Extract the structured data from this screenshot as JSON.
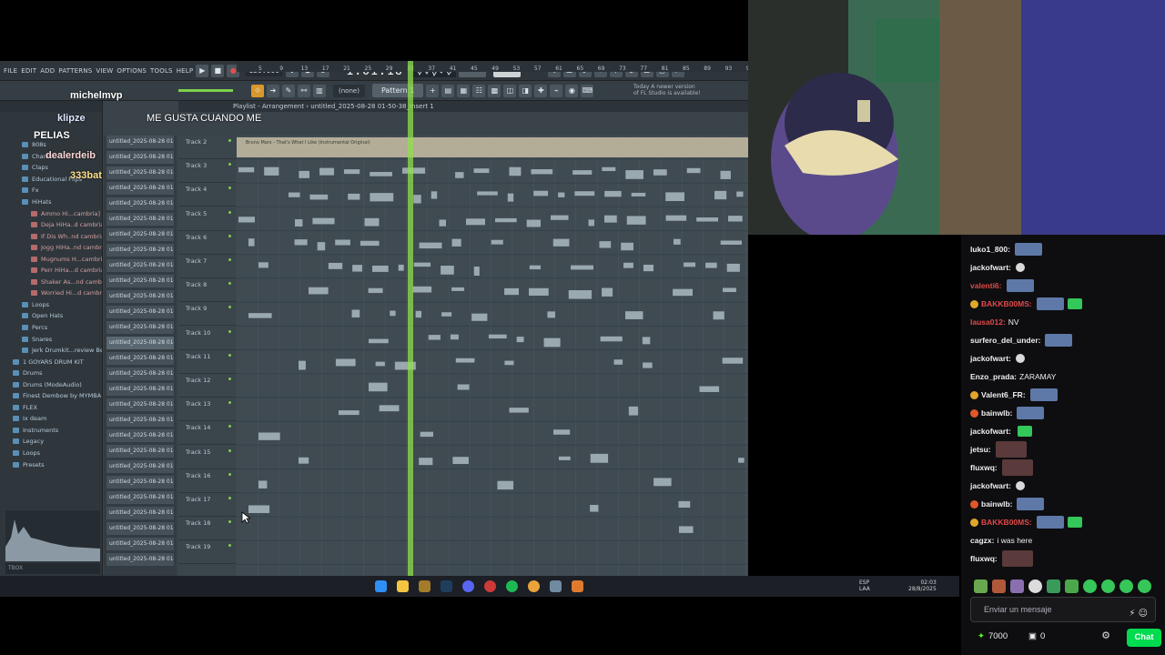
{
  "fl_studio": {
    "menu": [
      "FILE",
      "EDIT",
      "ADD",
      "PATTERNS",
      "VIEW",
      "OPTIONS",
      "TOOLS",
      "HELP"
    ],
    "bpm": "130.000",
    "time": "1:01:16",
    "pattern_select": "(none)",
    "pattern_button": "Pattern 1",
    "update_note": "Today  A newer version of FL Studio is available!",
    "playlist_title": "Playlist - Arrangement  ›  untitled_2025-08-28 01-50-38_Insert 1",
    "browser": {
      "items": [
        {
          "label": "808s",
          "level": 1
        },
        {
          "label": "Chants",
          "level": 1
        },
        {
          "label": "Claps",
          "level": 1
        },
        {
          "label": "Educational Flips",
          "level": 1
        },
        {
          "label": "Fx",
          "level": 1
        },
        {
          "label": "HiHats",
          "level": 1
        },
        {
          "label": "Ammo Hi...cambria]",
          "level": 2
        },
        {
          "label": "Deja HiHa..d cambria]",
          "level": 2
        },
        {
          "label": "If Dis Wh..nd cambria]",
          "level": 2
        },
        {
          "label": "Jogg HiHa..nd cambria]",
          "level": 2
        },
        {
          "label": "Mugnums H...cambria]",
          "level": 2
        },
        {
          "label": "Perr HiHa...d cambria]",
          "level": 2
        },
        {
          "label": "Shaker As...nd cambria]",
          "level": 2
        },
        {
          "label": "Worried Hi...d cambria]",
          "level": 2
        },
        {
          "label": "Loops",
          "level": 1
        },
        {
          "label": "Open Hats",
          "level": 1
        },
        {
          "label": "Percs",
          "level": 1
        },
        {
          "label": "Snares",
          "level": 1
        },
        {
          "label": "Jerk Drumkit...review Beats",
          "level": 1
        },
        {
          "label": "1 GOYARS DRUM KIT",
          "level": 0
        },
        {
          "label": "Drums",
          "level": 0
        },
        {
          "label": "Drums (ModeAudio)",
          "level": 0
        },
        {
          "label": "Finest Dembow by MYMBA",
          "level": 0
        },
        {
          "label": "FLEX",
          "level": 0
        },
        {
          "label": "Ix deam",
          "level": 0
        },
        {
          "label": "Instruments",
          "level": 0
        },
        {
          "label": "Legacy",
          "level": 0
        },
        {
          "label": "Loops",
          "level": 0
        },
        {
          "label": "Presets",
          "level": 0
        }
      ],
      "search_placeholder": "TBOX"
    },
    "pattern_label": "untitled_2025-08-28 01-",
    "pattern_count": 28,
    "tracks": [
      "Track 2",
      "Track 3",
      "Track 4",
      "Track 5",
      "Track 6",
      "Track 7",
      "Track 8",
      "Track 9",
      "Track 10",
      "Track 11",
      "Track 12",
      "Track 13",
      "Track 14",
      "Track 15",
      "Track 16",
      "Track 17",
      "Track 18",
      "Track 19"
    ],
    "ruler_marks": [
      "5",
      "9",
      "13",
      "17",
      "21",
      "25",
      "29",
      "33",
      "37",
      "41",
      "45",
      "49",
      "53",
      "57",
      "61",
      "65",
      "69",
      "73",
      "77",
      "81",
      "85",
      "89",
      "93",
      "97"
    ],
    "first_clip_label": "Bruno Mars - That's What I Like (Instrumental Original)"
  },
  "overlay": {
    "user1": "michelmvp",
    "user2": "klipze",
    "msg": "ME GUSTA CUANDO ME",
    "user3": "PELIAS",
    "user4": "dealerdeib",
    "user5": "333bat"
  },
  "taskbar": {
    "lang1": "ESP",
    "lang2": "LAA",
    "clock_time": "02:03",
    "clock_date": "28/8/2025"
  },
  "chat": {
    "messages": [
      {
        "user": "luko1_800:",
        "text": "",
        "color": "#efeff1"
      },
      {
        "user": "jackofwart:",
        "text": "",
        "color": "#efeff1"
      },
      {
        "user": "valenti6:",
        "text": "",
        "color": "#e04a4a"
      },
      {
        "user": "BAKKB00MS:",
        "text": "",
        "color": "#e04a4a"
      },
      {
        "user": "lausa012:",
        "text": "NV",
        "color": "#e04a4a"
      },
      {
        "user": "surfero_del_under:",
        "text": "",
        "color": "#efeff1"
      },
      {
        "user": "jackofwart:",
        "text": "",
        "color": "#efeff1"
      },
      {
        "user": "Enzo_prada:",
        "text": "ZARAMAY",
        "color": "#efeff1"
      },
      {
        "user": "Valent6_FR:",
        "text": "",
        "color": "#efeff1"
      },
      {
        "user": "bainwlb:",
        "text": "",
        "color": "#efeff1"
      },
      {
        "user": "jackofwart:",
        "text": "",
        "color": "#efeff1"
      },
      {
        "user": "jetsu:",
        "text": "",
        "color": "#efeff1"
      },
      {
        "user": "fluxwq:",
        "text": "",
        "color": "#efeff1"
      },
      {
        "user": "jackofwart:",
        "text": "",
        "color": "#efeff1"
      },
      {
        "user": "bainwlb:",
        "text": "",
        "color": "#efeff1"
      },
      {
        "user": "BAKKB00MS:",
        "text": "",
        "color": "#e04a4a"
      },
      {
        "user": "cagzx:",
        "text": "i was here",
        "color": "#efeff1"
      },
      {
        "user": "fluxwq:",
        "text": "",
        "color": "#efeff1"
      }
    ],
    "input_placeholder": "Enviar un mensaje",
    "points": "7000",
    "gifts": "0",
    "chat_button": "Chat"
  },
  "colors": {
    "kick_green": "#53fc18",
    "playhead": "#8fe04a",
    "clip": "#9aa8b0"
  }
}
